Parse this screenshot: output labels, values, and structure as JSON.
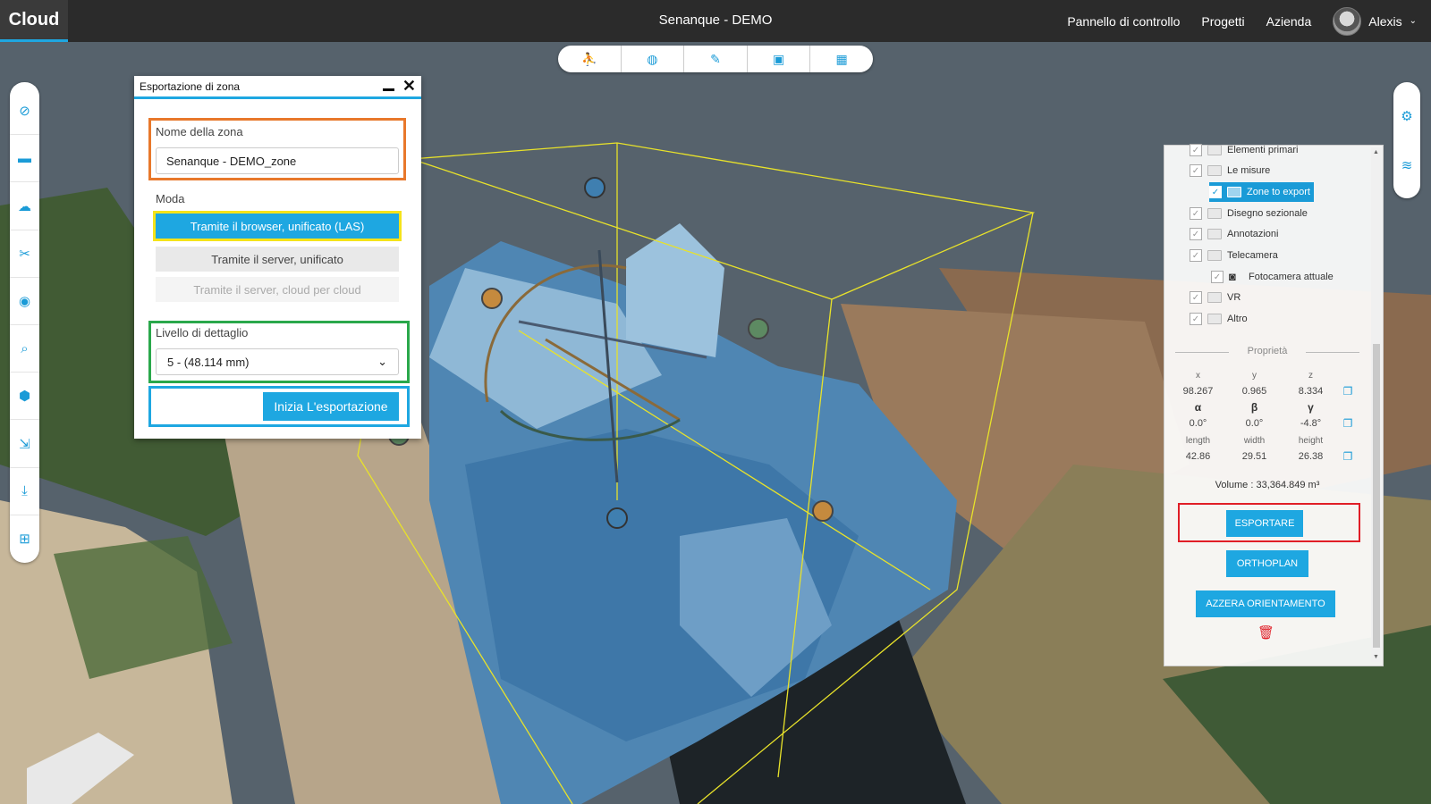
{
  "app": {
    "logo": "Cloud",
    "project_title": "Senanque - DEMO"
  },
  "nav": {
    "items": [
      "Pannello di controllo",
      "Progetti",
      "Azienda"
    ],
    "user": {
      "name": "Alexis",
      "chevron": "⌄"
    }
  },
  "top_tools": [
    {
      "icon": "binoculars-icon",
      "glyph": "⛹"
    },
    {
      "icon": "globe-icon",
      "glyph": "◍"
    },
    {
      "icon": "brush-icon",
      "glyph": "✎"
    },
    {
      "icon": "vr-headset-icon",
      "glyph": "▣"
    },
    {
      "icon": "calculator-icon",
      "glyph": "▦"
    }
  ],
  "left_tools": [
    {
      "icon": "compass-icon",
      "glyph": "⊘"
    },
    {
      "icon": "ruler-icon",
      "glyph": "▬"
    },
    {
      "icon": "comment-icon",
      "glyph": "☁"
    },
    {
      "icon": "scissors-icon",
      "glyph": "✂"
    },
    {
      "icon": "camera-icon",
      "glyph": "◉"
    },
    {
      "icon": "search-icon",
      "glyph": "⌕"
    },
    {
      "icon": "cube-icon",
      "glyph": "⬢"
    },
    {
      "icon": "file-export-icon",
      "glyph": "⇲"
    },
    {
      "icon": "download-icon",
      "glyph": "⤓"
    },
    {
      "icon": "grid-icon",
      "glyph": "⊞"
    }
  ],
  "right_tools": [
    {
      "icon": "cogs-icon",
      "glyph": "⚙"
    },
    {
      "icon": "layers-icon",
      "glyph": "≋"
    }
  ],
  "export_dialog": {
    "title": "Esportazione di zona",
    "zone_name_label": "Nome della zona",
    "zone_name_value": "Senanque - DEMO_zone",
    "mode_label": "Moda",
    "modes": [
      "Tramite il browser, unificato (LAS)",
      "Tramite il server, unificato",
      "Tramite il server, cloud per cloud"
    ],
    "selected_mode": 0,
    "level_label": "Livello di dettaglio",
    "level_value": "5 - (48.114 mm)",
    "start_button": "Inizia L'esportazione"
  },
  "tree": [
    {
      "label": "Elementi primari",
      "indent": 0
    },
    {
      "label": "Le misure",
      "indent": 0
    },
    {
      "label": "Zone to export",
      "indent": 1,
      "selected": true
    },
    {
      "label": "Disegno sezionale",
      "indent": 0
    },
    {
      "label": "Annotazioni",
      "indent": 0
    },
    {
      "label": "Telecamera",
      "indent": 0
    },
    {
      "label": "Fotocamera attuale",
      "indent": 1,
      "camera": true
    },
    {
      "label": "VR",
      "indent": 0
    },
    {
      "label": "Altro",
      "indent": 0
    }
  ],
  "properties": {
    "title": "Proprietà",
    "position": {
      "labels": [
        "x",
        "y",
        "z"
      ],
      "values": [
        "98.267",
        "0.965",
        "8.334"
      ]
    },
    "rotation": {
      "labels": [
        "α",
        "β",
        "γ"
      ],
      "values": [
        "0.0°",
        "0.0°",
        "-4.8°"
      ]
    },
    "size": {
      "labels": [
        "length",
        "width",
        "height"
      ],
      "values": [
        "42.86",
        "29.51",
        "26.38"
      ]
    },
    "volume": "Volume : 33,364.849 m³"
  },
  "panel_buttons": {
    "export": "ESPORTARE",
    "orthoplan": "ORTHOPLAN",
    "reset": "AZZERA ORIENTAMENTO"
  },
  "colors": {
    "accent": "#1ea7e1",
    "topbar": "#2b2b2b",
    "highlight_orange": "#e8782b",
    "highlight_green": "#2aa84b",
    "highlight_yellow": "#f5e31a",
    "highlight_red": "#e01e27"
  }
}
